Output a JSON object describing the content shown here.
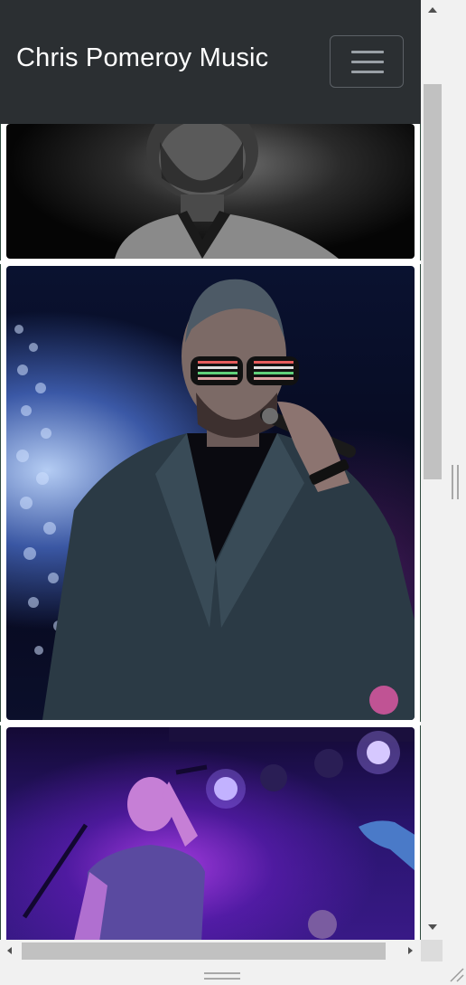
{
  "navbar": {
    "brand": "Chris Pomeroy Music",
    "toggler_icon": "hamburger-menu-icon"
  },
  "gallery": {
    "photos": [
      {
        "description": "black and white portrait, partially visible"
      },
      {
        "description": "singer with light-up shutter glasses holding microphone"
      },
      {
        "description": "singer on stage under purple lights"
      }
    ]
  },
  "colors": {
    "navbar_bg": "#2b2f32",
    "brand_text": "#ffffff",
    "card_border": "#2f4a3e",
    "scrollbar_thumb": "#c1c1c1"
  }
}
